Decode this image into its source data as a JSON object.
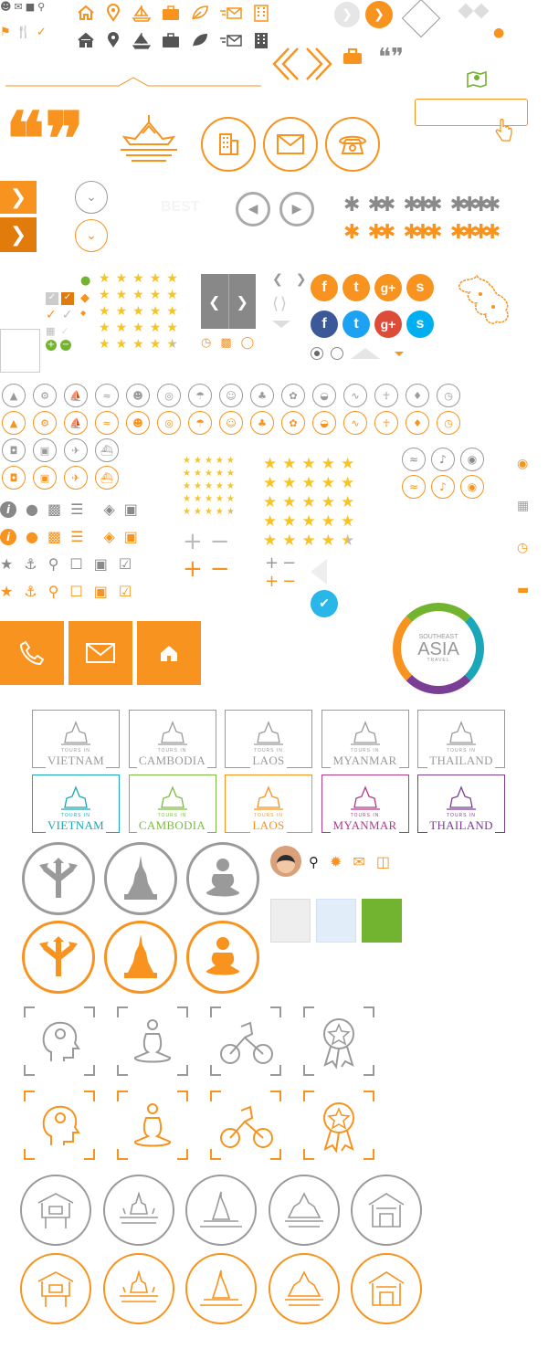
{
  "colors": {
    "orange": "#f7931e",
    "gray": "#8a8a8a",
    "dark": "#555555",
    "facebook": "#3b5998",
    "twitter": "#1da1f2",
    "googleplus": "#dd4b39",
    "skype": "#00aff0",
    "green_note": "#72b32f"
  },
  "label_best": "BEST",
  "social": {
    "facebook": "f",
    "twitter": "t",
    "googleplus": "g+",
    "skype": "s"
  },
  "quote_marks": "❝❞",
  "tours_in": "TOURS IN",
  "destinations": [
    "VIETNAM",
    "CAMBODIA",
    "LAOS",
    "MYANMAR",
    "THAILAND"
  ],
  "destination_colors": [
    "#1aa7b8",
    "#7dbb42",
    "#f7931e",
    "#b23a8a",
    "#7a3f94"
  ],
  "logo": {
    "line1": "SOUTHEAST",
    "line2": "ASIA",
    "line3": "TRAVEL"
  },
  "rating_rows": [
    5,
    5,
    5,
    5,
    4.5
  ],
  "plus": "+",
  "minus": "−"
}
